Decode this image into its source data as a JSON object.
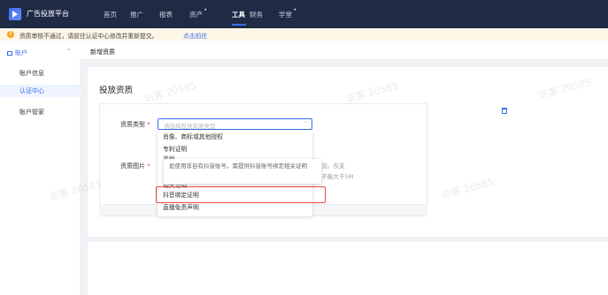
{
  "topbar": {
    "brand": "广告投放平台",
    "nav": [
      {
        "label": "首页"
      },
      {
        "label": "推广"
      },
      {
        "label": "报表"
      },
      {
        "label": "资产",
        "dot": "•"
      },
      {
        "label": "工具"
      },
      {
        "label": "财务"
      },
      {
        "label": "学堂",
        "dot": "•"
      }
    ]
  },
  "notice": {
    "icon": "!",
    "text": "资质审核不通过，请前往认证中心修改并重新提交。",
    "link": "点击前往"
  },
  "sidebar": {
    "header": "账户",
    "caret": "^",
    "items": [
      {
        "label": "账户信息"
      },
      {
        "label": "认证中心"
      },
      {
        "label": "账户管家"
      }
    ]
  },
  "main": {
    "page_title": "新增资质",
    "section_title": "投放资质",
    "type_label": "资质类型",
    "required_mark": "*",
    "select_placeholder": "请选择投放资质类型",
    "select_arrow": "˄",
    "image_label": "资质图片",
    "hint_line1": "可见。仅支",
    "hint_line2": "小不能大于5M"
  },
  "dropdown": {
    "items": [
      "肖像、商标或其他授权",
      "专利证明",
      "其他",
      "相关证明",
      "抖音绑定证明",
      "直播免责声明"
    ],
    "tooltip": "如使用非自有抖音账号，需提供抖音账号绑定相关证明"
  },
  "watermark": "访客 20585",
  "colors": {
    "accent": "#3d6cf0",
    "nav_bg": "#1f2b45",
    "highlight": "#e5484d"
  }
}
